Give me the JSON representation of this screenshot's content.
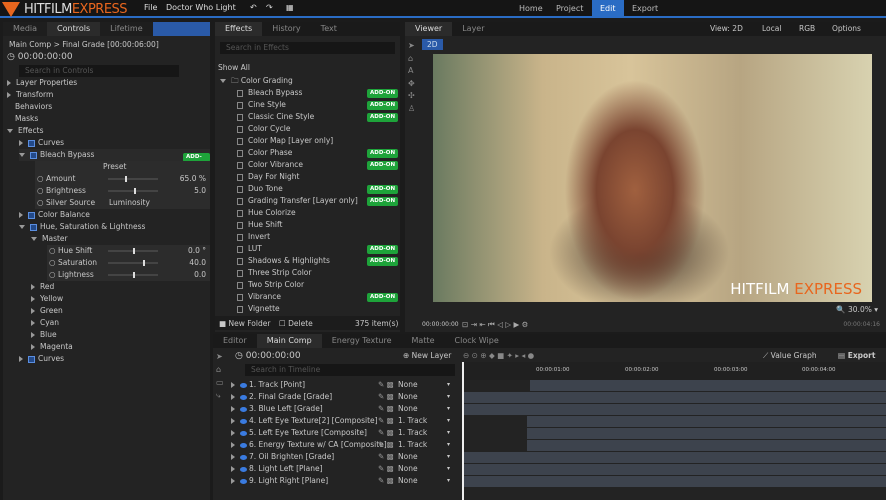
{
  "app": {
    "logo_white": "HITFILM",
    "logo_orange": " EXPRESS",
    "file": "File",
    "project_name": "Doctor Who Light"
  },
  "nav": [
    "Home",
    "Project",
    "Edit",
    "Export"
  ],
  "nav_active": "Edit",
  "controls": {
    "tabs": [
      "Media",
      "Controls",
      "Lifetime"
    ],
    "active": "Controls",
    "breadcrumb": "Main Comp > Final Grade [00:00:06:00]",
    "time": "00:00:00:00",
    "search_placeholder": "Search in Controls",
    "items": [
      "Layer Properties",
      "Transform",
      "Behaviors",
      "Masks",
      "Effects",
      "Curves",
      "Bleach Bypass",
      "Preset",
      "Amount",
      "65.0 %",
      "Brightness",
      "5.0",
      "Silver Source",
      "Luminosity",
      "Color Balance",
      "Hue, Saturation & Lightness",
      "Master",
      "Hue Shift",
      "0.0 °",
      "Saturation",
      "40.0",
      "Lightness",
      "0.0",
      "Red",
      "Yellow",
      "Green",
      "Cyan",
      "Blue",
      "Magenta",
      "Curves"
    ],
    "addon": "ADD-ON"
  },
  "effects": {
    "tabs": [
      "Effects",
      "History",
      "Text"
    ],
    "active": "Effects",
    "search_placeholder": "Search in Effects",
    "filter": "Show All",
    "folder": "Color Grading",
    "list": [
      {
        "n": "Bleach Bypass",
        "a": true
      },
      {
        "n": "Cine Style",
        "a": true
      },
      {
        "n": "Classic Cine Style",
        "a": true
      },
      {
        "n": "Color Cycle",
        "a": false
      },
      {
        "n": "Color Map [Layer only]",
        "a": false
      },
      {
        "n": "Color Phase",
        "a": true
      },
      {
        "n": "Color Vibrance",
        "a": true
      },
      {
        "n": "Day For Night",
        "a": false
      },
      {
        "n": "Duo Tone",
        "a": true
      },
      {
        "n": "Grading Transfer [Layer only]",
        "a": true
      },
      {
        "n": "Hue Colorize",
        "a": false
      },
      {
        "n": "Hue Shift",
        "a": false
      },
      {
        "n": "Invert",
        "a": false
      },
      {
        "n": "LUT",
        "a": true
      },
      {
        "n": "Shadows & Highlights",
        "a": true
      },
      {
        "n": "Three Strip Color",
        "a": false
      },
      {
        "n": "Two Strip Color",
        "a": false
      },
      {
        "n": "Vibrance",
        "a": true
      },
      {
        "n": "Vignette",
        "a": false
      }
    ],
    "new_folder": "New Folder",
    "delete": "Delete",
    "count": "375 item(s)"
  },
  "viewer": {
    "tabs": [
      "Viewer",
      "Layer"
    ],
    "active": "Viewer",
    "mode": "2D",
    "view": "View: 2D",
    "space": "Local",
    "channel": "RGB",
    "options": "Options",
    "zoom": "30.0%",
    "time": "00:00:00:00",
    "end_time": "00:00:04:16",
    "watermark_white": "HITFILM",
    "watermark_orange": " EXPRESS"
  },
  "timeline": {
    "tabs": [
      "Editor",
      "Main Comp",
      "Energy Texture",
      "Matte",
      "Clock Wipe"
    ],
    "active": "Main Comp",
    "time": "00:00:00:00",
    "new_layer": "New Layer",
    "search_placeholder": "Search in Timeline",
    "value_graph": "Value Graph",
    "export": "Export",
    "ruler": [
      "00:00:01:00",
      "00:00:02:00",
      "00:00:03:00",
      "00:00:04:00"
    ],
    "layers": [
      {
        "n": "1. Track [Point]",
        "p": "None"
      },
      {
        "n": "2. Final Grade [Grade]",
        "p": "None"
      },
      {
        "n": "3. Blue Left [Grade]",
        "p": "None"
      },
      {
        "n": "4. Left Eye Texture[2] [Composite]",
        "p": "1. Track"
      },
      {
        "n": "5. Left Eye Texture [Composite]",
        "p": "1. Track"
      },
      {
        "n": "6. Energy Texture w/ CA [Composite]",
        "p": "1. Track"
      },
      {
        "n": "7. Oil Brighten [Grade]",
        "p": "None"
      },
      {
        "n": "8. Light Left [Plane]",
        "p": "None"
      },
      {
        "n": "9. Light Right [Plane]",
        "p": "None"
      }
    ]
  }
}
